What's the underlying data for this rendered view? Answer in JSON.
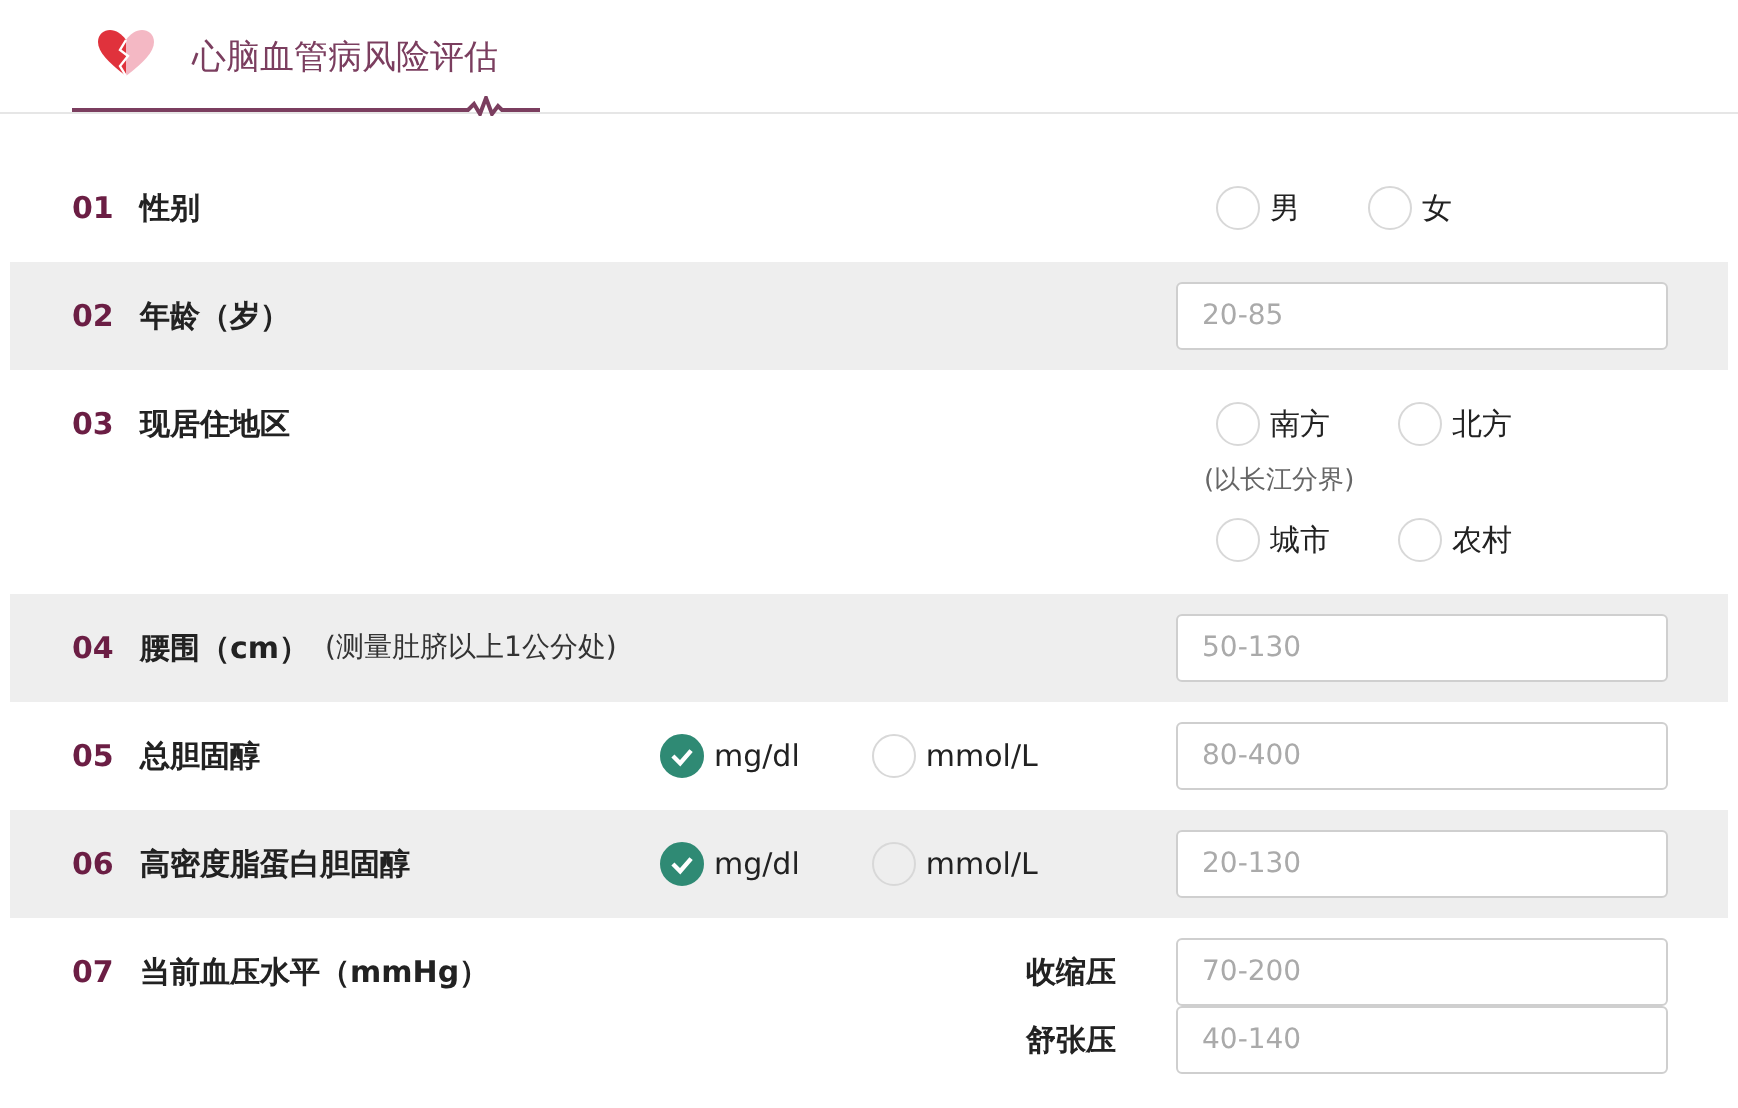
{
  "header": {
    "title": "心脑血管病风险评估"
  },
  "questions": [
    {
      "number": "01",
      "label": "性别",
      "kind": "choice",
      "groups": [
        {
          "options": [
            {
              "label": "男",
              "selected": false
            },
            {
              "label": "女",
              "selected": false
            }
          ]
        }
      ]
    },
    {
      "number": "02",
      "label": "年龄（岁）",
      "kind": "input",
      "fields": [
        {
          "placeholder": "20-85"
        }
      ]
    },
    {
      "number": "03",
      "label": "现居住地区",
      "kind": "choice",
      "groups": [
        {
          "options": [
            {
              "label": "南方",
              "selected": false
            },
            {
              "label": "北方",
              "selected": false
            }
          ],
          "note": "(以长江分界)"
        },
        {
          "options": [
            {
              "label": "城市",
              "selected": false
            },
            {
              "label": "农村",
              "selected": false
            }
          ]
        }
      ]
    },
    {
      "number": "04",
      "label": "腰围（cm）",
      "note": "(测量肚脐以上1公分处)",
      "kind": "input",
      "fields": [
        {
          "placeholder": "50-130"
        }
      ]
    },
    {
      "number": "05",
      "label": "总胆固醇",
      "kind": "unit-input",
      "units": [
        {
          "label": "mg/dl",
          "selected": true
        },
        {
          "label": "mmol/L",
          "selected": false
        }
      ],
      "fields": [
        {
          "placeholder": "80-400"
        }
      ]
    },
    {
      "number": "06",
      "label": "高密度脂蛋白胆固醇",
      "kind": "unit-input",
      "units": [
        {
          "label": "mg/dl",
          "selected": true
        },
        {
          "label": "mmol/L",
          "selected": false
        }
      ],
      "fields": [
        {
          "placeholder": "20-130"
        }
      ]
    },
    {
      "number": "07",
      "label": "当前血压水平（mmHg）",
      "kind": "labeled-inputs",
      "fields": [
        {
          "label": "收缩压",
          "placeholder": "70-200"
        },
        {
          "label": "舒张压",
          "placeholder": "40-140"
        }
      ]
    }
  ]
}
